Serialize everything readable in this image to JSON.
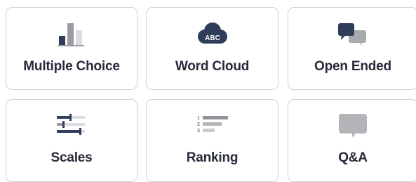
{
  "options": [
    {
      "label": "Multiple Choice",
      "icon": "bar-chart-icon"
    },
    {
      "label": "Word Cloud",
      "icon": "word-cloud-icon",
      "icon_text": "ABC"
    },
    {
      "label": "Open Ended",
      "icon": "chat-bubbles-icon"
    },
    {
      "label": "Scales",
      "icon": "sliders-icon"
    },
    {
      "label": "Ranking",
      "icon": "ranking-icon",
      "rank_numbers": [
        "1",
        "2",
        "3"
      ]
    },
    {
      "label": "Q&A",
      "icon": "qa-bubble-icon"
    }
  ],
  "colors": {
    "dark_navy": "#2f3d5b",
    "mid_gray": "#9a9ca2",
    "light_gray": "#cfd0d4",
    "bubble_gray": "#b2b4b8",
    "text": "#272a3a",
    "border": "#cfd0d6"
  }
}
